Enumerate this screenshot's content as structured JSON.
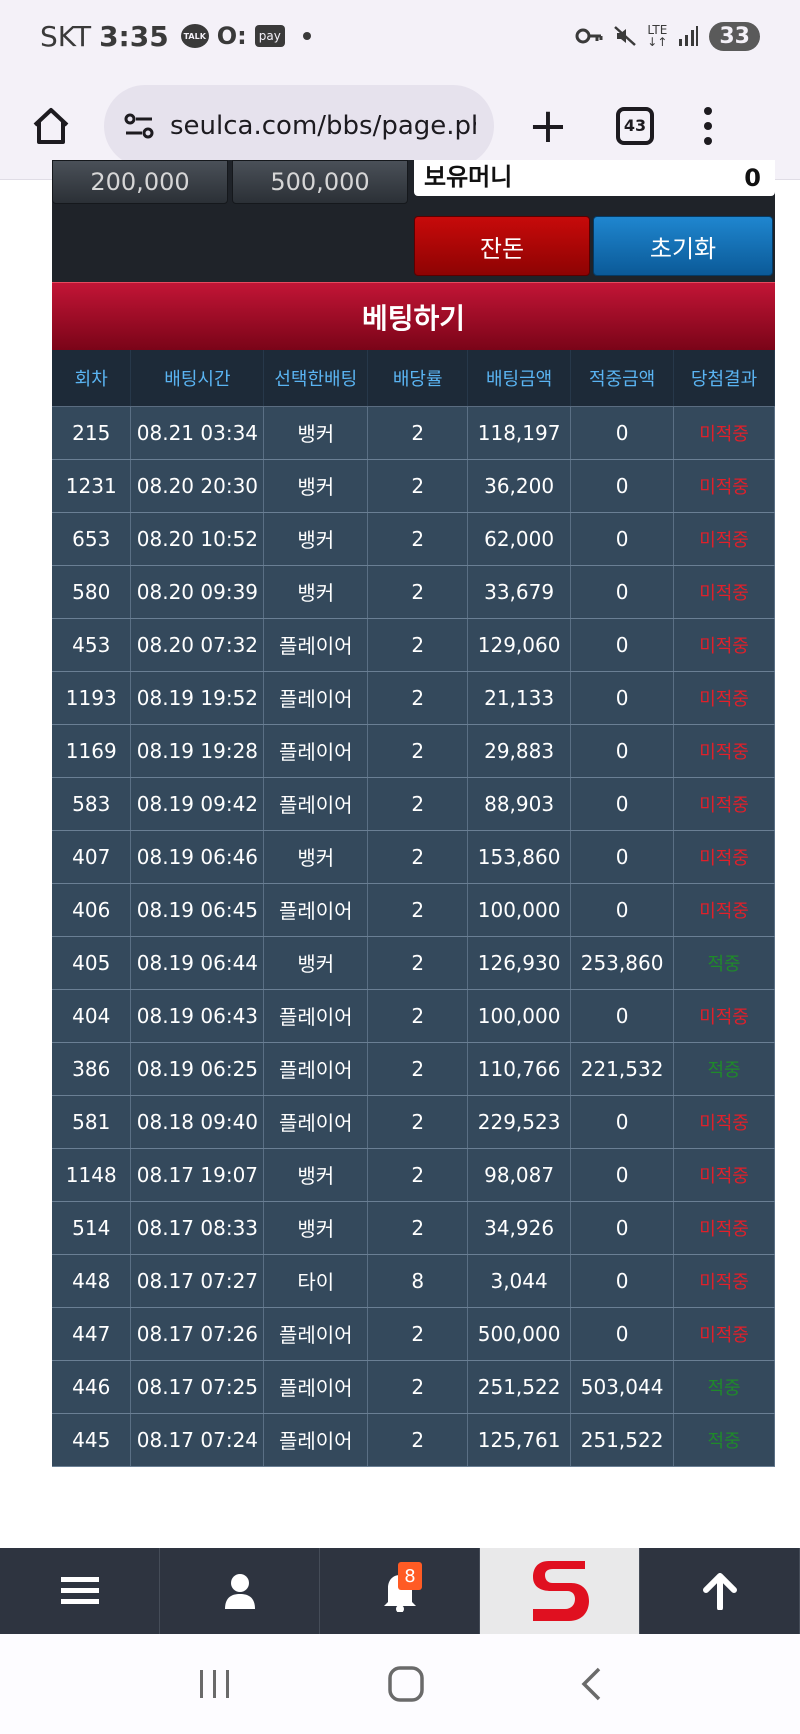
{
  "status_bar": {
    "carrier": "SKT",
    "time": "3:35",
    "talk_label": "TALK",
    "o_label": "O:",
    "pay_label": "pay",
    "lte_label": "LTE",
    "battery": "33"
  },
  "browser": {
    "url": "seulca.com/bbs/page.php",
    "tab_count": "43"
  },
  "top_panel": {
    "amount_left": "200,000",
    "amount_right": "500,000",
    "bonus_label": "보유머니",
    "bonus_value": "0",
    "change_label": "잔돈",
    "reset_label": "초기화"
  },
  "bet_header": "베팅하기",
  "table": {
    "headers": [
      "회차",
      "배팅시간",
      "선택한배팅",
      "배당률",
      "배팅금액",
      "적중금액",
      "당첨결과"
    ],
    "rows": [
      [
        "215",
        "08.21 03:34",
        "뱅커",
        "2",
        "118,197",
        "0",
        "미적중"
      ],
      [
        "1231",
        "08.20 20:30",
        "뱅커",
        "2",
        "36,200",
        "0",
        "미적중"
      ],
      [
        "653",
        "08.20 10:52",
        "뱅커",
        "2",
        "62,000",
        "0",
        "미적중"
      ],
      [
        "580",
        "08.20 09:39",
        "뱅커",
        "2",
        "33,679",
        "0",
        "미적중"
      ],
      [
        "453",
        "08.20 07:32",
        "플레이어",
        "2",
        "129,060",
        "0",
        "미적중"
      ],
      [
        "1193",
        "08.19 19:52",
        "플레이어",
        "2",
        "21,133",
        "0",
        "미적중"
      ],
      [
        "1169",
        "08.19 19:28",
        "플레이어",
        "2",
        "29,883",
        "0",
        "미적중"
      ],
      [
        "583",
        "08.19 09:42",
        "플레이어",
        "2",
        "88,903",
        "0",
        "미적중"
      ],
      [
        "407",
        "08.19 06:46",
        "뱅커",
        "2",
        "153,860",
        "0",
        "미적중"
      ],
      [
        "406",
        "08.19 06:45",
        "플레이어",
        "2",
        "100,000",
        "0",
        "미적중"
      ],
      [
        "405",
        "08.19 06:44",
        "뱅커",
        "2",
        "126,930",
        "253,860",
        "적중"
      ],
      [
        "404",
        "08.19 06:43",
        "플레이어",
        "2",
        "100,000",
        "0",
        "미적중"
      ],
      [
        "386",
        "08.19 06:25",
        "플레이어",
        "2",
        "110,766",
        "221,532",
        "적중"
      ],
      [
        "581",
        "08.18 09:40",
        "플레이어",
        "2",
        "229,523",
        "0",
        "미적중"
      ],
      [
        "1148",
        "08.17 19:07",
        "뱅커",
        "2",
        "98,087",
        "0",
        "미적중"
      ],
      [
        "514",
        "08.17 08:33",
        "뱅커",
        "2",
        "34,926",
        "0",
        "미적중"
      ],
      [
        "448",
        "08.17 07:27",
        "타이",
        "8",
        "3,044",
        "0",
        "미적중"
      ],
      [
        "447",
        "08.17 07:26",
        "플레이어",
        "2",
        "500,000",
        "0",
        "미적중"
      ],
      [
        "446",
        "08.17 07:25",
        "플레이어",
        "2",
        "251,522",
        "503,044",
        "적중"
      ],
      [
        "445",
        "08.17 07:24",
        "플레이어",
        "2",
        "125,761",
        "251,522",
        "적중"
      ]
    ]
  },
  "bottom_nav": {
    "notification_count": "8",
    "icons": [
      "menu-icon",
      "user-icon",
      "bell-icon",
      "logo-s",
      "arrow-up-icon"
    ]
  },
  "colors": {
    "miss": "#e0202a",
    "hit": "#1f8a2a",
    "header_text": "#5ab4f2",
    "row_bg": "#34495c",
    "bet_header": "#a30b26"
  }
}
